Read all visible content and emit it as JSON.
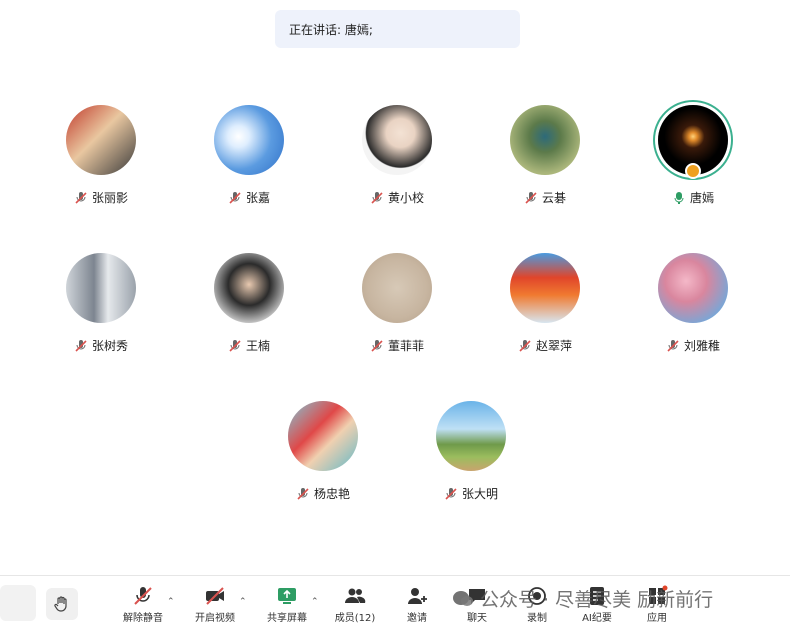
{
  "speaking_banner": {
    "text": "正在讲话: 唐嫣;"
  },
  "participants": [
    {
      "name": "张丽影",
      "mic": "muted"
    },
    {
      "name": "张嘉",
      "mic": "muted"
    },
    {
      "name": "黄小校",
      "mic": "muted"
    },
    {
      "name": "云碁",
      "mic": "muted"
    },
    {
      "name": "唐嫣",
      "mic": "speaking",
      "host": true
    },
    {
      "name": "张树秀",
      "mic": "muted"
    },
    {
      "name": "王楠",
      "mic": "muted"
    },
    {
      "name": "董菲菲",
      "mic": "muted"
    },
    {
      "name": "赵翠萍",
      "mic": "muted"
    },
    {
      "name": "刘雅稚",
      "mic": "muted"
    },
    {
      "name": "杨忠艳",
      "mic": "muted"
    },
    {
      "name": "张大明",
      "mic": "muted"
    }
  ],
  "toolbar": {
    "unmute": "解除静音",
    "start_video": "开启视频",
    "share_screen": "共享屏幕",
    "members": "成员(12)",
    "invite": "邀请",
    "chat": "聊天",
    "record": "录制",
    "ai_minutes": "AI纪要",
    "apps": "应用"
  },
  "watermark": {
    "text": "公众号 · 尽善尽美 励新前行"
  },
  "colors": {
    "accent": "#3bb08f",
    "muted_red": "#d9534f",
    "speaking_green": "#2e9d64",
    "banner_bg": "#eef2fb"
  }
}
